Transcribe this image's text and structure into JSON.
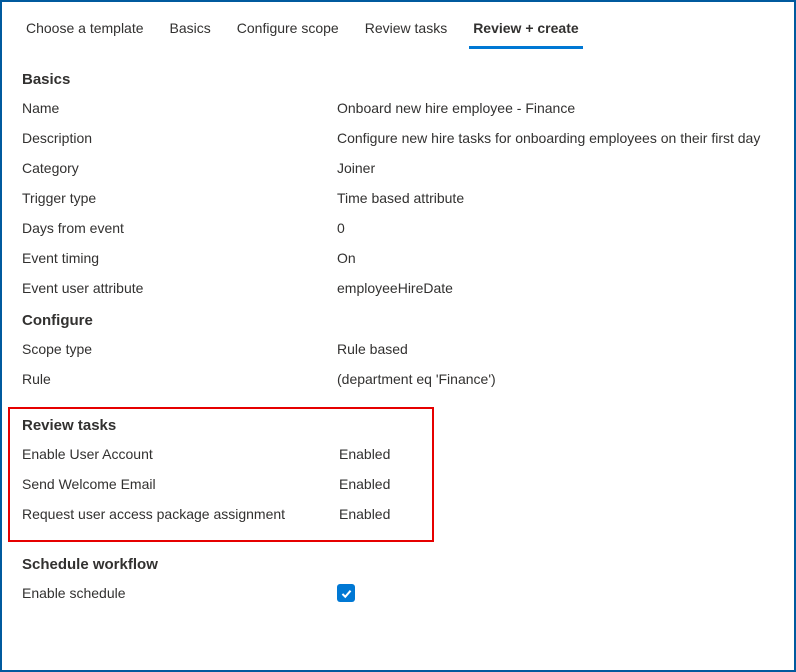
{
  "tabs": {
    "choose_template": "Choose a template",
    "basics": "Basics",
    "configure_scope": "Configure scope",
    "review_tasks": "Review tasks",
    "review_create": "Review + create"
  },
  "sections": {
    "basics": {
      "title": "Basics",
      "rows": {
        "name_label": "Name",
        "name_value": "Onboard new hire employee - Finance",
        "description_label": "Description",
        "description_value": "Configure new hire tasks for onboarding employees on their first day",
        "category_label": "Category",
        "category_value": "Joiner",
        "trigger_type_label": "Trigger type",
        "trigger_type_value": "Time based attribute",
        "days_from_event_label": "Days from event",
        "days_from_event_value": "0",
        "event_timing_label": "Event timing",
        "event_timing_value": "On",
        "event_user_attribute_label": "Event user attribute",
        "event_user_attribute_value": "employeeHireDate"
      }
    },
    "configure": {
      "title": "Configure",
      "rows": {
        "scope_type_label": "Scope type",
        "scope_type_value": "Rule based",
        "rule_label": "Rule",
        "rule_value": " (department eq 'Finance')"
      }
    },
    "review_tasks": {
      "title": "Review tasks",
      "rows": {
        "enable_user_account_label": "Enable User Account",
        "enable_user_account_value": "Enabled",
        "send_welcome_email_label": "Send Welcome Email",
        "send_welcome_email_value": "Enabled",
        "request_access_pkg_label": "Request user access package assignment",
        "request_access_pkg_value": "Enabled"
      }
    },
    "schedule_workflow": {
      "title": "Schedule workflow",
      "enable_schedule_label": "Enable schedule",
      "enable_schedule_checked": true
    }
  }
}
